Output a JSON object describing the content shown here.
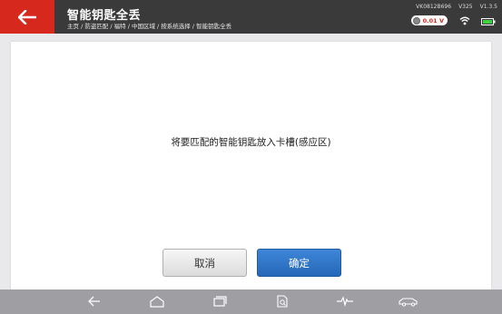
{
  "header": {
    "title": "智能钥匙全丢",
    "breadcrumb": "主页 / 防盗匹配 / 福特 / 中国区域 / 按系统选择 / 智能钥匙全丢",
    "device_id": "VK0812B696",
    "app_version": "V325",
    "sw_version": "V1.3.5",
    "voltage": "0.01 V",
    "accent_color": "#d7281d"
  },
  "main": {
    "message": "将要匹配的智能钥匙放入卡槽(感应区)",
    "cancel_label": "取消",
    "confirm_label": "确定"
  },
  "navbar": {
    "icons": [
      "back-icon",
      "home-icon",
      "recent-apps-icon",
      "document-search-icon",
      "diagnostic-pulse-icon",
      "vci-car-icon"
    ]
  }
}
